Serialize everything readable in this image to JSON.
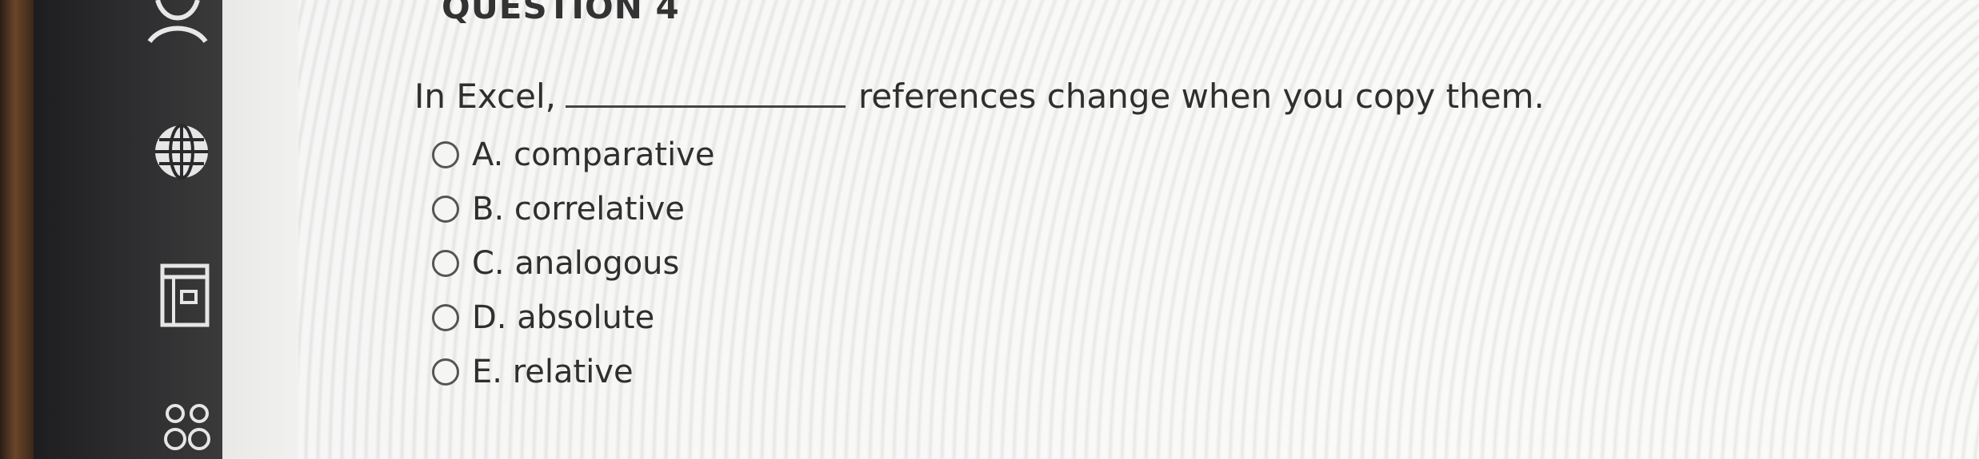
{
  "question": {
    "number_label": "QUESTION 4",
    "text_before_blank": "In Excel,",
    "text_after_blank": "references change when you copy them.",
    "options": [
      {
        "label": "A. comparative"
      },
      {
        "label": "B. correlative"
      },
      {
        "label": "C. analogous"
      },
      {
        "label": "D. absolute"
      },
      {
        "label": "E. relative"
      }
    ]
  },
  "sidebar": {
    "icons": [
      "person-icon",
      "globe-icon",
      "calculator-icon",
      "group-icon"
    ]
  }
}
